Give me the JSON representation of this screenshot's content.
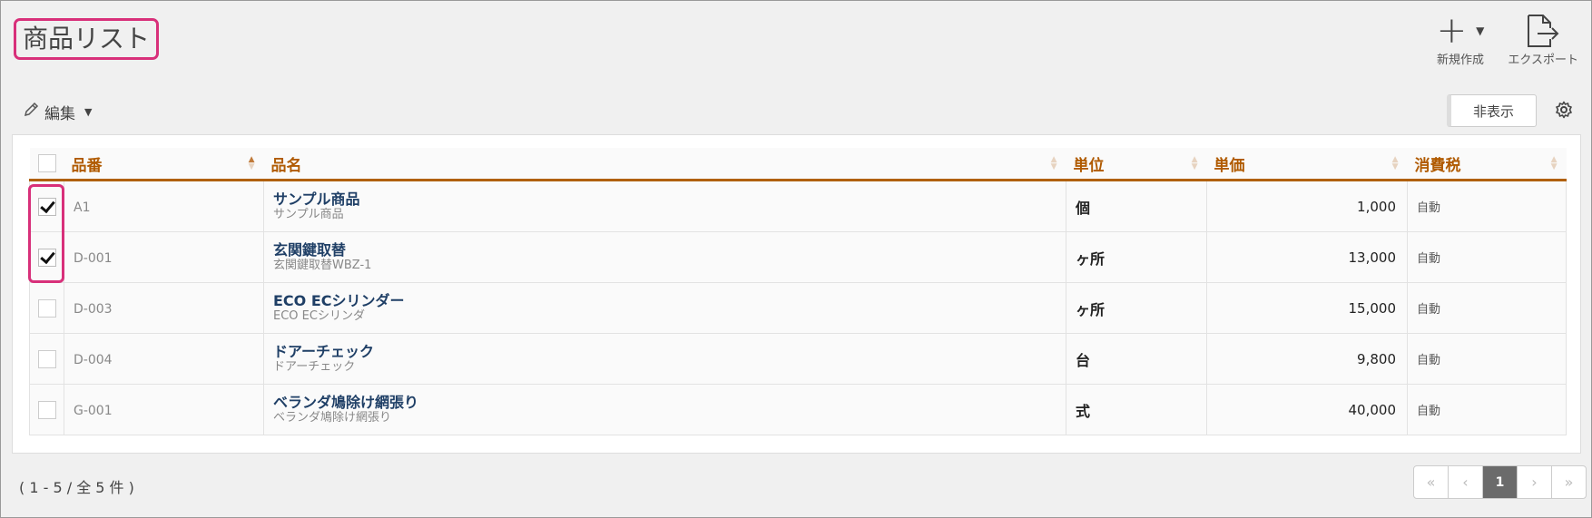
{
  "header": {
    "title": "商品リスト",
    "new_label": "新規作成",
    "export_label": "エクスポート"
  },
  "toolbar": {
    "edit_label": "編集",
    "hide_label": "非表示"
  },
  "table": {
    "columns": [
      "品番",
      "品名",
      "単位",
      "単価",
      "消費税"
    ],
    "rows": [
      {
        "checked": true,
        "code": "A1",
        "name": "サンプル商品",
        "subname": "サンプル商品",
        "unit": "個",
        "price": "1,000",
        "tax": "自動"
      },
      {
        "checked": true,
        "code": "D-001",
        "name": "玄関鍵取替",
        "subname": "玄関鍵取替WBZ-1",
        "unit": "ヶ所",
        "price": "13,000",
        "tax": "自動"
      },
      {
        "checked": false,
        "code": "D-003",
        "name": "ECO ECシリンダー",
        "subname": "ECO ECシリンダ",
        "unit": "ヶ所",
        "price": "15,000",
        "tax": "自動"
      },
      {
        "checked": false,
        "code": "D-004",
        "name": "ドアーチェック",
        "subname": "ドアーチェック",
        "unit": "台",
        "price": "9,800",
        "tax": "自動"
      },
      {
        "checked": false,
        "code": "G-001",
        "name": "ベランダ鳩除け網張り",
        "subname": "ベランダ鳩除け網張り",
        "unit": "式",
        "price": "40,000",
        "tax": "自動"
      }
    ]
  },
  "footer": {
    "count_text": "( 1 - 5 / 全 5 件 )",
    "pager": {
      "first": "«",
      "prev": "‹",
      "current": "1",
      "next": "›",
      "last": "»"
    }
  },
  "colors": {
    "highlight": "#d8307a",
    "header_text": "#b05a00",
    "link": "#1f3f66"
  }
}
